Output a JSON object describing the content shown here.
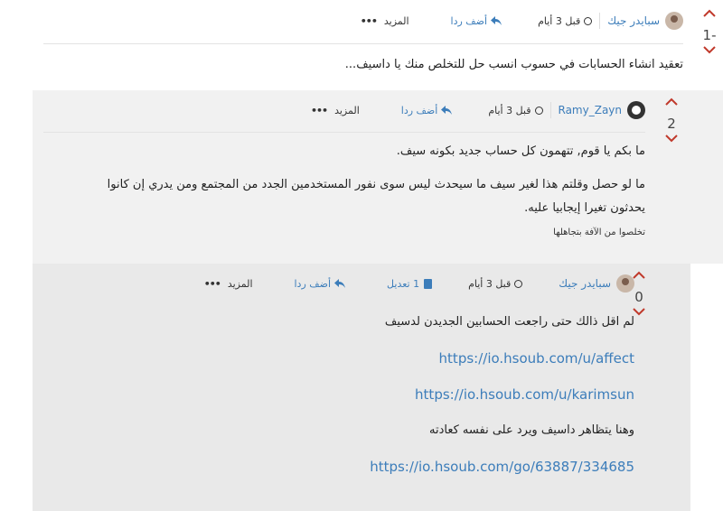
{
  "posts": [
    {
      "votes": "-1",
      "author": "سبايدر جيك",
      "time": "قبل 3 أيام",
      "reply_label": "أضف ردا",
      "more_label": "المزيد",
      "more_icon": "•••",
      "text": "تعقيد انشاء الحسابات في حسوب انسب حل للتخلص منك يا داسيف..."
    },
    {
      "votes": "2",
      "author": "Ramy_Zayn",
      "time": "قبل 3 أيام",
      "reply_label": "أضف ردا",
      "more_label": "المزيد",
      "more_icon": "•••",
      "paragraphs": [
        "ما بكم يا قوم, تتهمون كل حساب جديد بكونه سيف.",
        "ما لو حصل وقلتم هذا لغير سيف ما سيحدث ليس سوى نفور المستخدمين الجدد من المجتمع ومن يدري إن كانوا",
        "يحدثون تغيرا إيجابيا عليه."
      ],
      "signature": "تخلصوا من الآفة بتجاهلها"
    },
    {
      "votes": "0",
      "author": "سبايدر جيك",
      "time": "قبل 3 أيام",
      "edit_label": "1 تعديل",
      "reply_label": "أضف ردا",
      "more_label": "المزيد",
      "more_icon": "•••",
      "line1": "لم اقل ذالك حتى راجعت الحسابين الجديدن لدسيف",
      "link1": "https://io.hsoub.com/u/affect",
      "link2": "https://io.hsoub.com/u/karimsun",
      "line2": "وهنا يتظاهر داسيف ويرد على نفسه كعادته",
      "link3": "https://io.hsoub.com/go/63887/334685"
    }
  ],
  "colors": {
    "accent": "#3c7dba",
    "vote_arrow": "#c0392b"
  }
}
